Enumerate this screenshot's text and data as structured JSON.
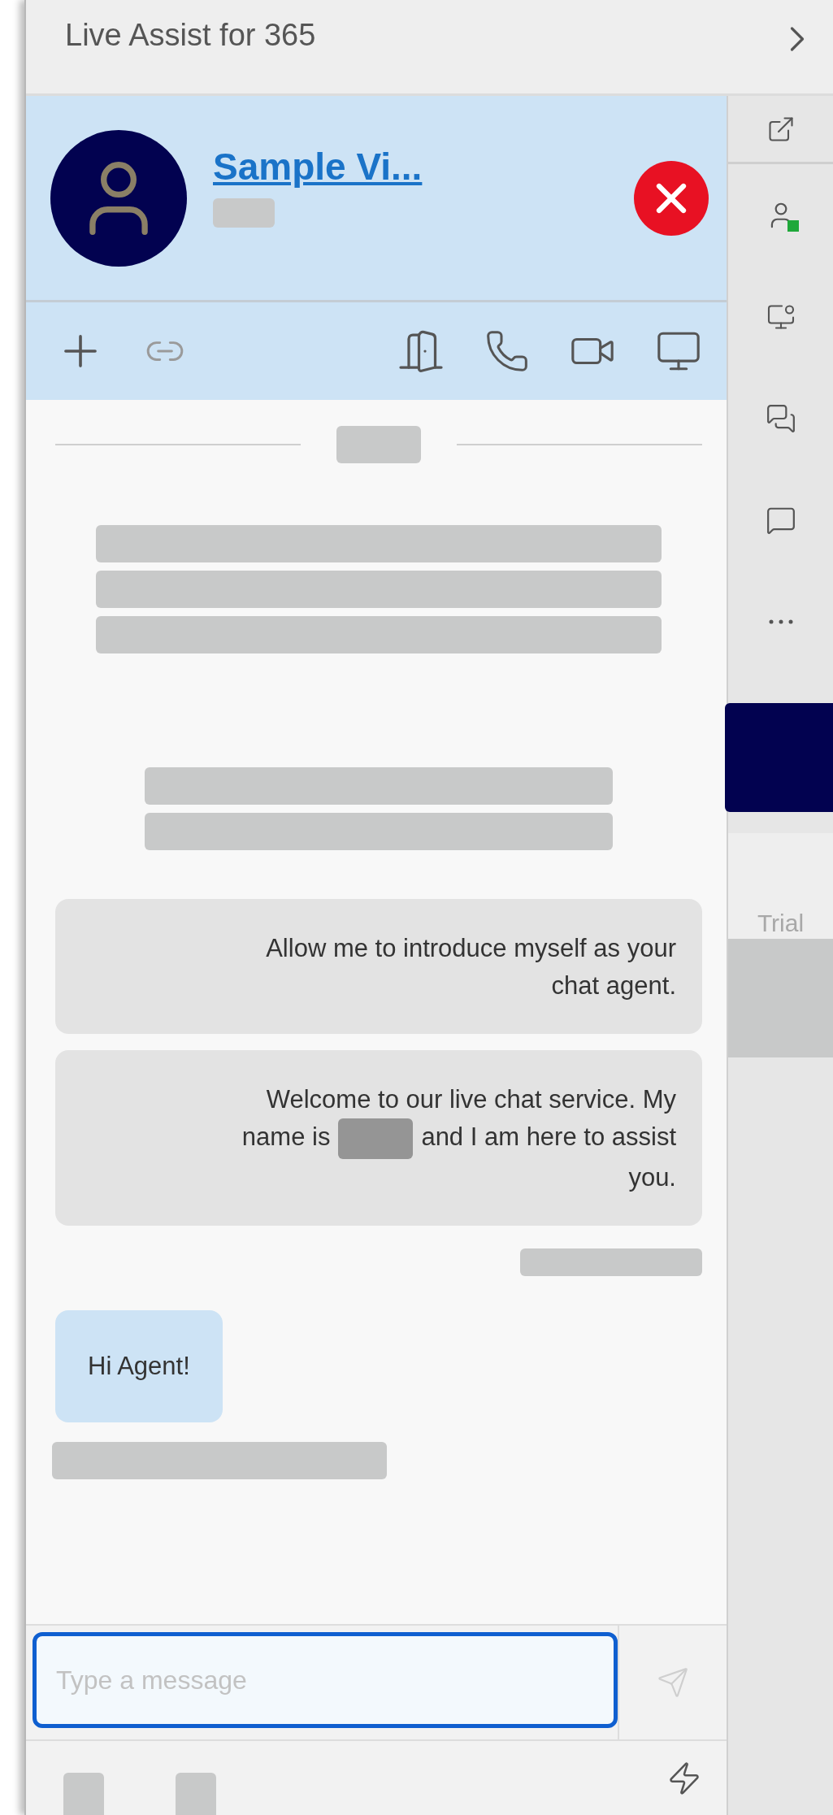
{
  "window": {
    "title": "Live Assist for 365"
  },
  "visitor": {
    "name": "Sample Vi..."
  },
  "chat": {
    "items": [
      {
        "kind": "divider"
      },
      {
        "kind": "notice",
        "large": true
      },
      {
        "kind": "notice",
        "large": false
      },
      {
        "kind": "message",
        "outgoing": true,
        "text_parts": [
          "Allow me to introduce myself as your chat agent."
        ]
      },
      {
        "kind": "message",
        "outgoing": true,
        "text_parts": [
          "Welcome to our live chat service. My name is",
          "and I am here to assist you."
        ]
      },
      {
        "kind": "meta",
        "outgoing": true
      },
      {
        "kind": "message",
        "outgoing": false,
        "text_parts": [
          "Hi Agent!"
        ]
      },
      {
        "kind": "meta",
        "outgoing": false
      }
    ]
  },
  "composer": {
    "placeholder": "Type a message",
    "focused": true,
    "send_disabled": true
  },
  "rail": {
    "agent_online": true,
    "trial_label": "Trial"
  }
}
